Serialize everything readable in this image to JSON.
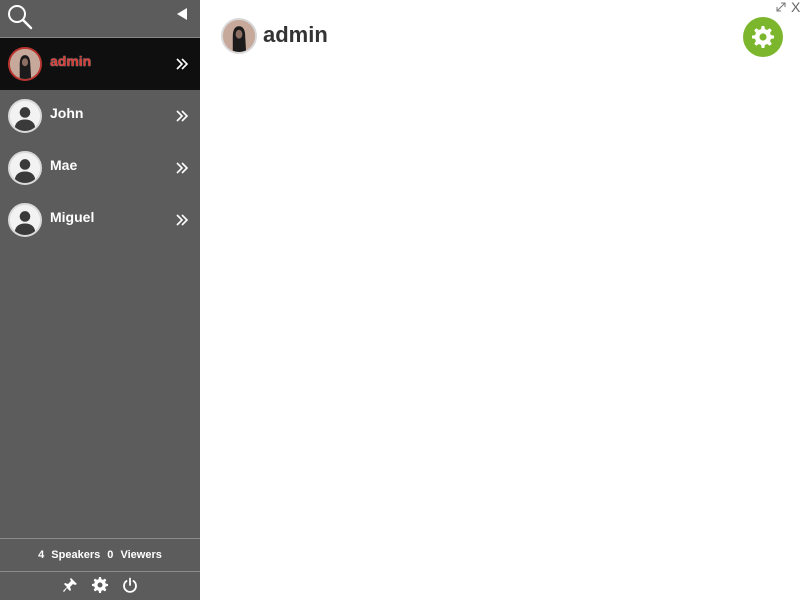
{
  "sidebar": {
    "users": [
      {
        "name": "admin",
        "active": true
      },
      {
        "name": "John",
        "active": false
      },
      {
        "name": "Mae",
        "active": false
      },
      {
        "name": "Miguel",
        "active": false
      }
    ],
    "footer": {
      "speakers_count": "4",
      "speakers_label": "Speakers",
      "viewers_count": "0",
      "viewers_label": "Viewers"
    }
  },
  "main": {
    "title": "admin",
    "close_label": "X"
  },
  "colors": {
    "sidebar_bg": "#5c5c5c",
    "active_row_bg": "#0f0f0f",
    "active_name": "#d73d36",
    "settings_button": "#7bb62d"
  },
  "icons": [
    "search-icon",
    "collapse-arrow-icon",
    "double-chevron-right-icon",
    "pin-icon",
    "gear-icon",
    "power-icon",
    "expand-icon"
  ]
}
